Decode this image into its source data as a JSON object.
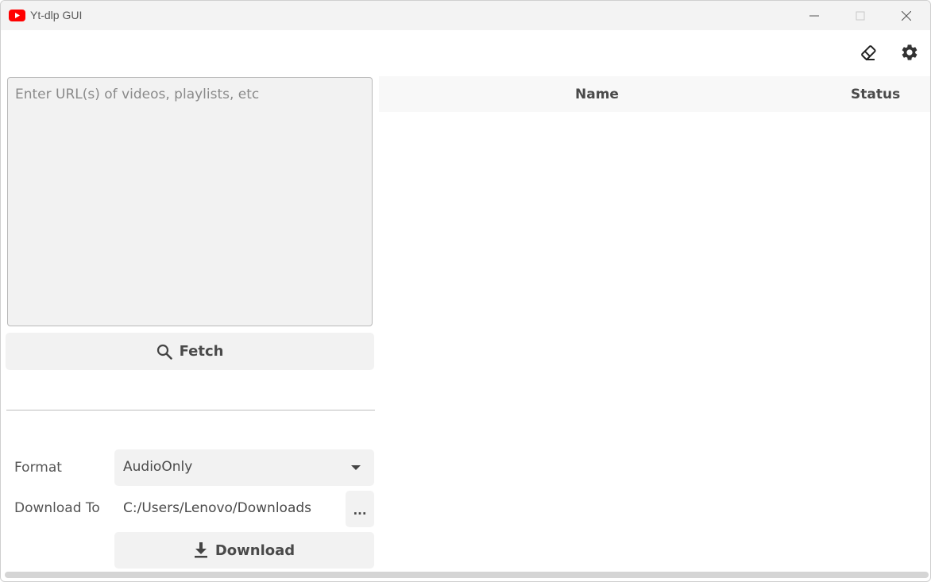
{
  "window": {
    "title": "Yt-dlp GUI",
    "icon": "youtube-logo-icon",
    "controls": [
      "minimize-icon",
      "maximize-icon",
      "close-icon"
    ]
  },
  "toolbar": {
    "icons": [
      "eraser-icon",
      "gear-icon"
    ]
  },
  "url_input": {
    "placeholder": "Enter URL(s) of videos, playlists, etc",
    "value": ""
  },
  "fetch_button": {
    "label": "Fetch",
    "icon": "search-icon"
  },
  "format": {
    "label": "Format",
    "selected": "AudioOnly",
    "icon": "caret-down-icon"
  },
  "download_to": {
    "label": "Download To",
    "path": "C:/Users/Lenovo/Downloads",
    "browse_label": "..."
  },
  "download_button": {
    "label": "Download",
    "icon": "download-icon"
  },
  "table": {
    "columns": [
      "Name",
      "Status"
    ],
    "rows": []
  },
  "colors": {
    "accent": "#ff0000",
    "button_bg": "#f2f2f2",
    "text": "#4a4a4a"
  }
}
